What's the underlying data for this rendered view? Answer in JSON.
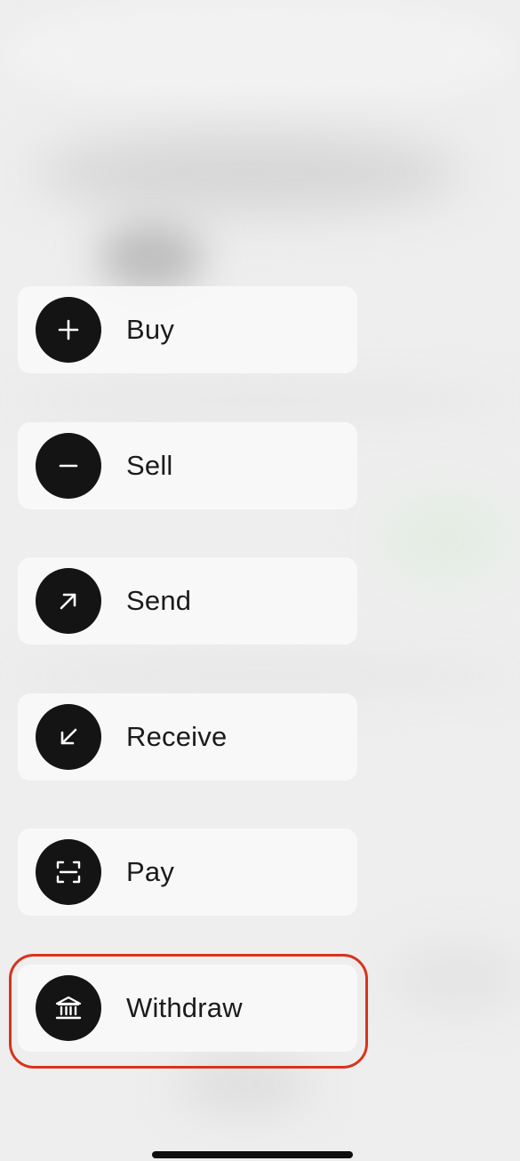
{
  "actions": [
    {
      "label": "Buy",
      "icon": "plus-icon"
    },
    {
      "label": "Sell",
      "icon": "minus-icon"
    },
    {
      "label": "Send",
      "icon": "arrow-up-right-icon"
    },
    {
      "label": "Receive",
      "icon": "arrow-down-left-icon"
    },
    {
      "label": "Pay",
      "icon": "scan-icon"
    },
    {
      "label": "Withdraw",
      "icon": "bank-icon"
    }
  ],
  "highlighted_action": "Withdraw",
  "colors": {
    "icon_background": "#141414",
    "highlight_border": "#d9331c",
    "card_background": "#f8f8f8"
  }
}
